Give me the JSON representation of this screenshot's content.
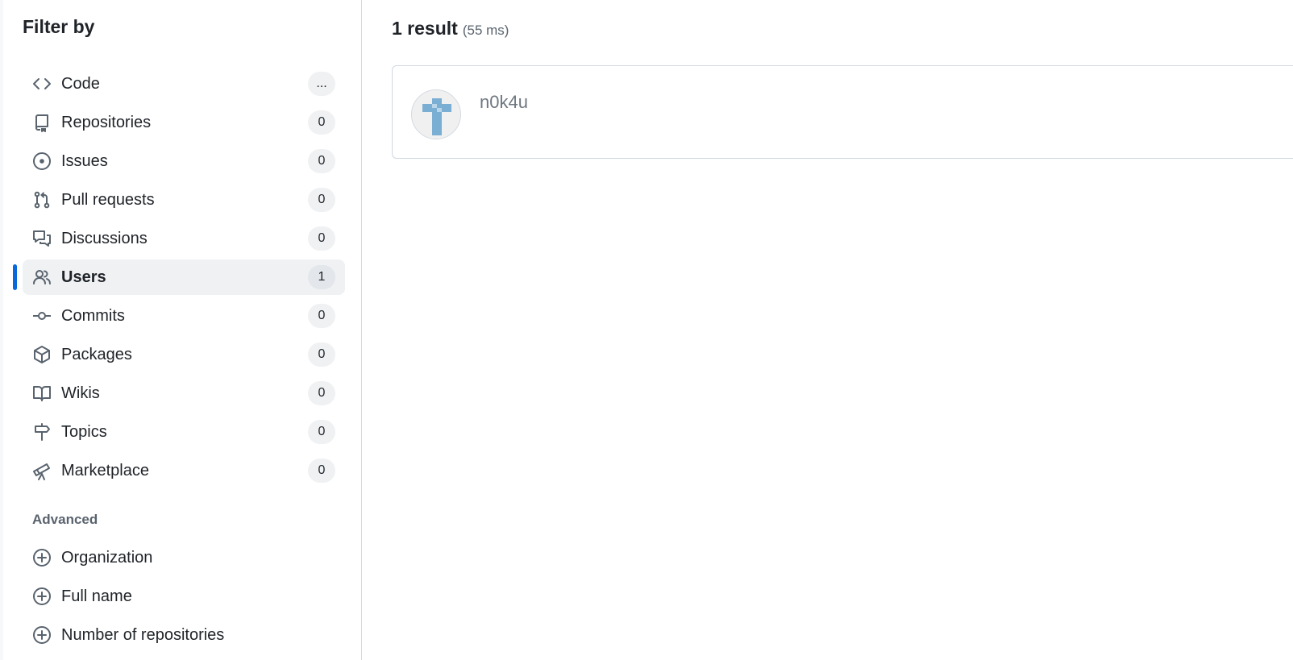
{
  "sidebar": {
    "title": "Filter by",
    "items": [
      {
        "label": "Code",
        "count": "...",
        "icon": "code-icon"
      },
      {
        "label": "Repositories",
        "count": "0",
        "icon": "repo-icon"
      },
      {
        "label": "Issues",
        "count": "0",
        "icon": "issue-icon"
      },
      {
        "label": "Pull requests",
        "count": "0",
        "icon": "pull-request-icon"
      },
      {
        "label": "Discussions",
        "count": "0",
        "icon": "discussion-icon"
      },
      {
        "label": "Users",
        "count": "1",
        "icon": "people-icon",
        "active": true
      },
      {
        "label": "Commits",
        "count": "0",
        "icon": "commit-icon"
      },
      {
        "label": "Packages",
        "count": "0",
        "icon": "package-icon"
      },
      {
        "label": "Wikis",
        "count": "0",
        "icon": "book-icon"
      },
      {
        "label": "Topics",
        "count": "0",
        "icon": "signpost-icon"
      },
      {
        "label": "Marketplace",
        "count": "0",
        "icon": "telescope-icon"
      }
    ],
    "advanced": {
      "heading": "Advanced",
      "items": [
        {
          "label": "Organization",
          "icon": "plus-circle-icon"
        },
        {
          "label": "Full name",
          "icon": "plus-circle-icon"
        },
        {
          "label": "Number of repositories",
          "icon": "plus-circle-icon"
        }
      ]
    }
  },
  "main": {
    "results_count": "1 result",
    "results_time": "(55 ms)",
    "results": [
      {
        "login": "n0k4u",
        "avatar_icon": "identicon-avatar"
      }
    ]
  },
  "colors": {
    "accent": "#0969da",
    "active_bg": "#eff1f3",
    "muted_text": "#59636e",
    "border": "#d1d9e0",
    "identicon": "#7aaed3"
  }
}
